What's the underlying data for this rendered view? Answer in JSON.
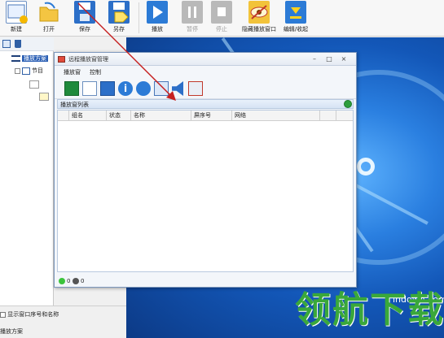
{
  "toolbar": {
    "items": [
      {
        "label": "新建",
        "icon": "new-file-icon"
      },
      {
        "label": "打开",
        "icon": "open-folder-icon"
      },
      {
        "label": "保存",
        "icon": "save-disk-icon"
      },
      {
        "label": "另存",
        "icon": "save-as-icon"
      },
      {
        "label": "播放",
        "icon": "play-icon"
      },
      {
        "label": "暂停",
        "icon": "pause-icon"
      },
      {
        "label": "停止",
        "icon": "stop-icon"
      },
      {
        "label": "隐藏播放窗口",
        "icon": "hide-window-icon"
      },
      {
        "label": "编辑/收起",
        "icon": "collapse-icon"
      }
    ]
  },
  "tree": {
    "root_label": "播放方案",
    "child_label": "节目"
  },
  "left_status": {
    "checkbox_label": "显示窗口序号和名称",
    "status_label": "播放方案"
  },
  "dialog": {
    "title": "远程播放窗管理",
    "menu": [
      "播放窗",
      "控制"
    ],
    "panel_title": "播放窗列表",
    "columns": [
      "组名",
      "状态",
      "名称",
      "屏序号",
      "网络"
    ],
    "status": {
      "online_count": "0",
      "offline_count": "0"
    }
  },
  "watermark": {
    "site": "lhdown.com",
    "brand": "领航下载"
  },
  "colors": {
    "accent_blue": "#2b5fb4",
    "play_blue": "#2c7bd6",
    "desktop_blue": "#1357b8",
    "led_online": "#3cc43c",
    "led_offline": "#555555",
    "watermark_green": "#3aa83a"
  }
}
